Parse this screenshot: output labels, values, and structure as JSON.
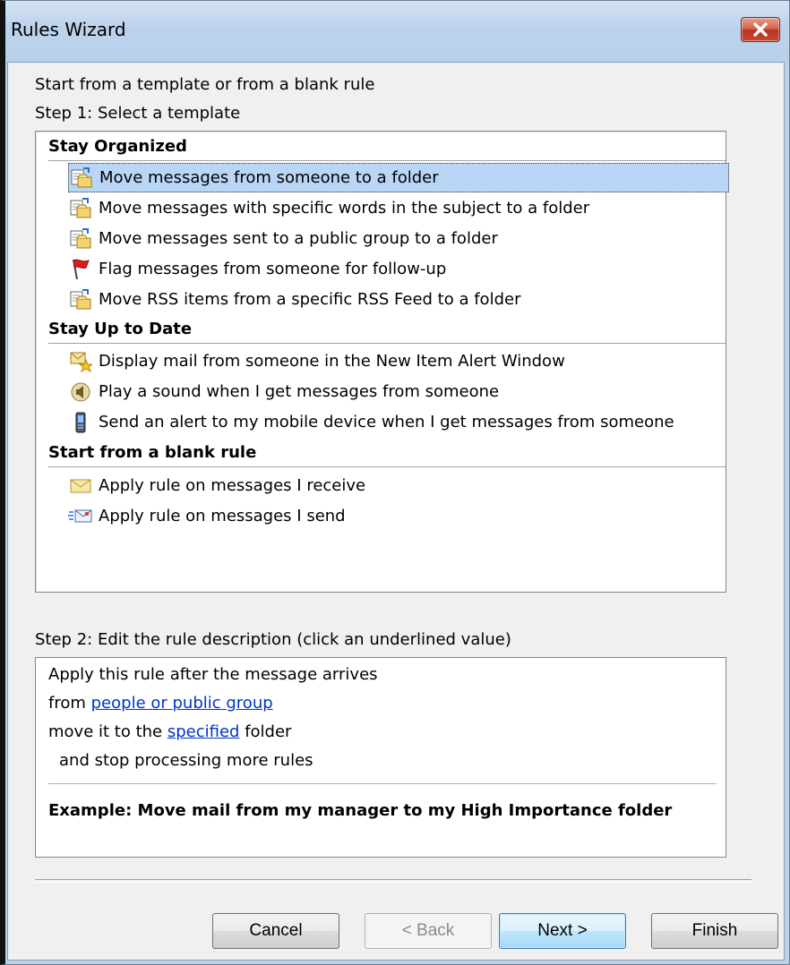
{
  "window": {
    "title": "Rules Wizard"
  },
  "intro": {
    "line1": "Start from a template or from a blank rule",
    "step1": "Step 1: Select a template"
  },
  "templates": {
    "groups": [
      {
        "label": "Stay Organized"
      },
      {
        "label": "Stay Up to Date"
      },
      {
        "label": "Start from a blank rule"
      }
    ],
    "items": [
      {
        "label": "Move messages from someone to a folder",
        "icon": "move-to-folder-icon",
        "selected": true
      },
      {
        "label": "Move messages with specific words in the subject to a folder",
        "icon": "move-to-folder-icon"
      },
      {
        "label": "Move messages sent to a public group to a folder",
        "icon": "move-to-folder-icon"
      },
      {
        "label": "Flag messages from someone for follow-up",
        "icon": "red-flag-icon"
      },
      {
        "label": "Move RSS items from a specific RSS Feed to a folder",
        "icon": "move-to-folder-icon"
      },
      {
        "label": "Display mail from someone in the New Item Alert Window",
        "icon": "new-item-alert-icon"
      },
      {
        "label": "Play a sound when I get messages from someone",
        "icon": "speaker-icon"
      },
      {
        "label": "Send an alert to my mobile device when I get messages from someone",
        "icon": "mobile-device-icon"
      },
      {
        "label": "Apply rule on messages I receive",
        "icon": "envelope-icon"
      },
      {
        "label": "Apply rule on messages I send",
        "icon": "send-mail-icon"
      }
    ]
  },
  "step2": {
    "label": "Step 2: Edit the rule description (click an underlined value)",
    "line1": "Apply this rule after the message arrives",
    "line2_prefix": "from ",
    "line2_link": "people or public group",
    "line3_prefix": "move it to the ",
    "line3_link": "specified",
    "line3_suffix": " folder",
    "line4": "and stop processing more rules",
    "example": "Example: Move mail from my manager to my High Importance folder"
  },
  "buttons": {
    "cancel": "Cancel",
    "back": "< Back",
    "next": "Next >",
    "finish": "Finish"
  },
  "colors": {
    "selection": "#bad6f6",
    "link": "#0033cc",
    "close_button": "#c8472f"
  }
}
